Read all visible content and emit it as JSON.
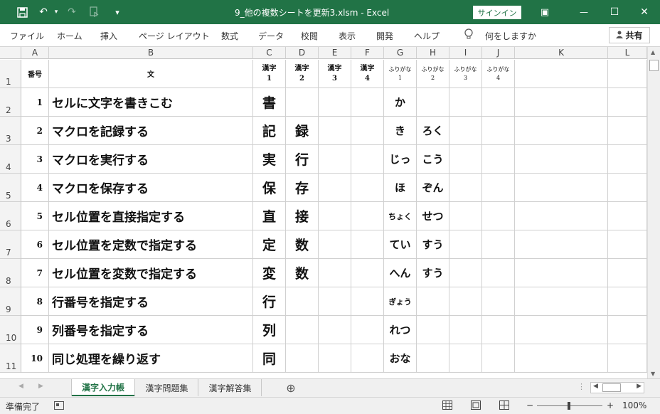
{
  "titlebar": {
    "title": "9_他の複数シートを更新3.xlsm  -  Excel",
    "signin": "サインイン",
    "save_icon": "💾",
    "undo_icon": "↶",
    "redo_icon": "↷",
    "customize_icon": "▾",
    "restore_icon": "▣",
    "min_icon": "—",
    "max_icon": "☐",
    "close_icon": "✕"
  },
  "ribbon": {
    "tabs": [
      "ファイル",
      "ホーム",
      "挿入",
      "ページ レイアウト",
      "数式",
      "データ",
      "校閲",
      "表示",
      "開発",
      "ヘルプ"
    ],
    "tell_me": "何をしますか",
    "bulb_icon": "💡",
    "share": "共有"
  },
  "columns": [
    "A",
    "B",
    "C",
    "D",
    "E",
    "F",
    "G",
    "H",
    "I",
    "J",
    "K",
    "L"
  ],
  "row_numbers": [
    "1",
    "2",
    "3",
    "4",
    "5",
    "6",
    "7",
    "8",
    "9",
    "10",
    "11"
  ],
  "header_row": {
    "num": "番号",
    "text": "文",
    "kanji1": "漢字",
    "kanji1_n": "1",
    "kanji2": "漢字",
    "kanji2_n": "2",
    "kanji3": "漢字",
    "kanji3_n": "3",
    "kanji4": "漢字",
    "kanji4_n": "4",
    "furi1": "ふりがな",
    "furi1_n": "1",
    "furi2": "ふりがな",
    "furi2_n": "2",
    "furi3": "ふりがな",
    "furi3_n": "3",
    "furi4": "ふりがな",
    "furi4_n": "4"
  },
  "rows": [
    {
      "num": "1",
      "text": "セルに文字を書きこむ",
      "k1": "書",
      "k2": "",
      "f1": "か",
      "f2": ""
    },
    {
      "num": "2",
      "text": "マクロを記録する",
      "k1": "記",
      "k2": "録",
      "f1": "き",
      "f2": "ろく"
    },
    {
      "num": "3",
      "text": "マクロを実行する",
      "k1": "実",
      "k2": "行",
      "f1": "じっ",
      "f2": "こう"
    },
    {
      "num": "4",
      "text": "マクロを保存する",
      "k1": "保",
      "k2": "存",
      "f1": "ほ",
      "f2": "ぞん"
    },
    {
      "num": "5",
      "text": "セル位置を直接指定する",
      "k1": "直",
      "k2": "接",
      "f1": "ちょく",
      "f2": "せつ"
    },
    {
      "num": "6",
      "text": "セル位置を定数で指定する",
      "k1": "定",
      "k2": "数",
      "f1": "てい",
      "f2": "すう"
    },
    {
      "num": "7",
      "text": "セル位置を変数で指定する",
      "k1": "変",
      "k2": "数",
      "f1": "へん",
      "f2": "すう"
    },
    {
      "num": "8",
      "text": "行番号を指定する",
      "k1": "行",
      "k2": "",
      "f1": "ぎょう",
      "f2": ""
    },
    {
      "num": "9",
      "text": "列番号を指定する",
      "k1": "列",
      "k2": "",
      "f1": "れつ",
      "f2": ""
    },
    {
      "num": "10",
      "text": "同じ処理を繰り返す",
      "k1": "同",
      "k2": "",
      "f1": "おな",
      "f2": ""
    }
  ],
  "sheets": [
    "漢字入力帳",
    "漢字問題集",
    "漢字解答集"
  ],
  "add_sheet_icon": "⊕",
  "status": {
    "ready": "準備完了",
    "zoom": "100%",
    "minus": "−",
    "plus": "+"
  }
}
